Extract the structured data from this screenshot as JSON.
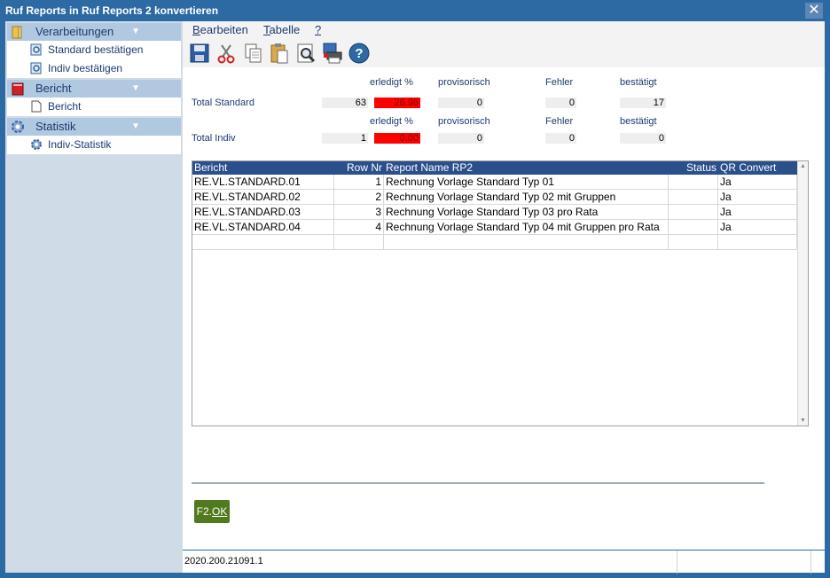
{
  "window": {
    "title": "Ruf Reports in Ruf Reports 2 konvertieren",
    "close_glyph": "✕"
  },
  "sidebar": {
    "groups": [
      {
        "label": "Verarbeitungen",
        "icon": "folder-icon",
        "items": [
          {
            "label": "Standard bestätigen",
            "icon": "refresh-doc-icon"
          },
          {
            "label": "Indiv bestätigen",
            "icon": "refresh-doc-icon"
          }
        ]
      },
      {
        "label": "Bericht",
        "icon": "report-book-icon",
        "items": [
          {
            "label": "Bericht",
            "icon": "document-icon"
          }
        ]
      },
      {
        "label": "Statistik",
        "icon": "gear-icon",
        "items": [
          {
            "label": "Indiv-Statistik",
            "icon": "gear-icon"
          }
        ]
      }
    ],
    "chevron": "▼"
  },
  "menu": {
    "bearbeiten": "Bearbeiten",
    "tabelle": "Tabelle",
    "help": "?"
  },
  "toolbar": [
    "save-icon",
    "cut-icon",
    "copy-icon",
    "paste-icon",
    "preview-icon",
    "print-icon",
    "help-icon"
  ],
  "stats": {
    "headers": {
      "done": "erledigt %",
      "provisional": "provisorisch",
      "errors": "Fehler",
      "confirmed": "bestätigt"
    },
    "standard": {
      "label": "Total Standard",
      "count": "63",
      "done": "26.98",
      "provisional": "0",
      "errors": "0",
      "confirmed": "17"
    },
    "indiv": {
      "label": "Total Indiv",
      "count": "1",
      "done": "0.00",
      "provisional": "0",
      "errors": "0",
      "confirmed": "0"
    }
  },
  "grid": {
    "columns": [
      "Bericht",
      "Row Nr",
      "Report Name RP2",
      "Status",
      "QR Convert"
    ],
    "rows": [
      [
        "RE.VL.STANDARD.01",
        "1",
        "Rechnung Vorlage Standard Typ 01",
        "",
        "Ja"
      ],
      [
        "RE.VL.STANDARD.02",
        "2",
        "Rechnung Vorlage Standard Typ 02 mit Gruppen",
        "",
        "Ja"
      ],
      [
        "RE.VL.STANDARD.03",
        "3",
        "Rechnung Vorlage Standard Typ 03 pro Rata",
        "",
        "Ja"
      ],
      [
        "RE.VL.STANDARD.04",
        "4",
        "Rechnung Vorlage Standard Typ 04 mit Gruppen pro Rata",
        "",
        "Ja"
      ]
    ]
  },
  "ok_button": {
    "prefix": "F2.",
    "label": "OK"
  },
  "status": {
    "version": "2020.200.21091.1"
  },
  "colors": {
    "accent": "#2d6aa3",
    "red": "#ff0000",
    "ok": "#4f7a1e",
    "grid_header": "#2a4f8c"
  }
}
